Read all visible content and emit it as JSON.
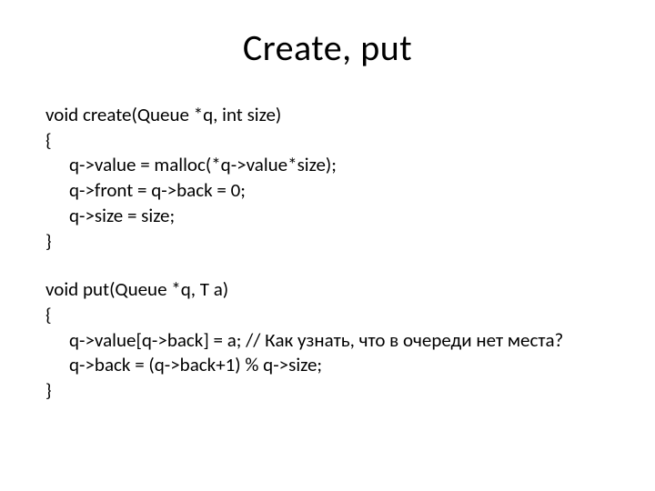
{
  "title": "Create, put",
  "code": {
    "create": {
      "sig": "void create(Queue *q, int size)",
      "open": "{",
      "l1": "q->value = malloc(*q->value*size);",
      "l2": "q->front = q->back = 0;",
      "l3": "q->size = size;",
      "close": "}"
    },
    "put": {
      "sig": "void put(Queue *q, T a)",
      "open": "{",
      "l1_code": "q->value[q->back] = a; ",
      "l1_comment": "// Как узнать, что в очереди нет места?",
      "l2": "q->back = (q->back+1) % q->size;",
      "close": "}"
    }
  }
}
